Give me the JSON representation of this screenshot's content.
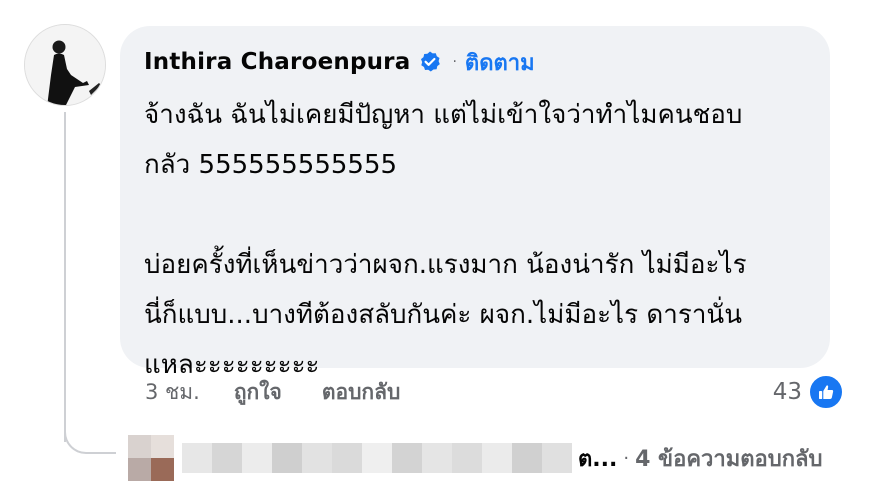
{
  "comment": {
    "author": "Inthira Charoenpura",
    "follow_label": "ติดตาม",
    "separator": "·",
    "text": "จ้างฉัน ฉันไม่เคยมีปัญหา แต่ไม่เข้าใจว่าทำไมคนชอบ\nกลัว 555555555555\n\nบ่อยครั้งที่เห็นข่าวว่าผจก.แรงมาก น้องน่ารัก ไม่มีอะไร\nนี่ก็แบบ...บางทีต้องสลับกันค่ะ ผจก.ไม่มีอะไร ดารานั่น\nแหละะะะะะะะะ",
    "time": "3 ชม.",
    "like_label": "ถูกใจ",
    "reply_label": "ตอบกลับ",
    "reaction_count": "43"
  },
  "reply_preview": {
    "name_visible": "ต...",
    "separator": "·",
    "count_label": "4 ข้อความตอบกลับ"
  },
  "colors": {
    "bubble": "#f0f2f5",
    "accent": "#1877f2",
    "muted": "#65676b"
  }
}
